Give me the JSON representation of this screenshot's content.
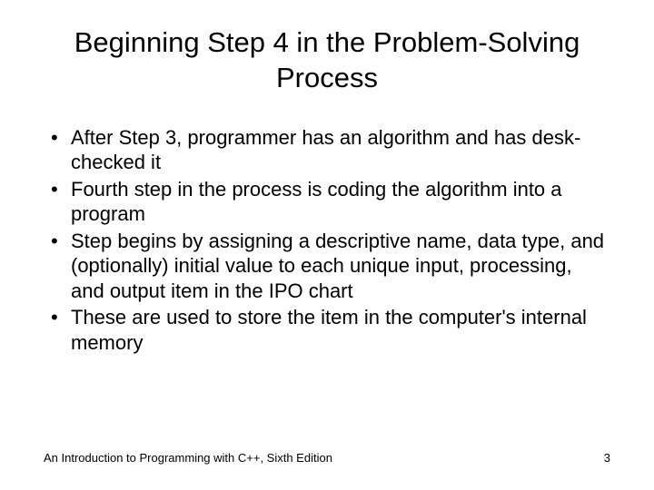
{
  "title": "Beginning Step 4 in the Problem-Solving Process",
  "bullets": [
    "After Step 3, programmer has an algorithm and has desk-checked it",
    "Fourth step in the process is coding the algorithm into a program",
    "Step begins by assigning a descriptive name, data type, and (optionally) initial value to each unique input, processing, and output item in the IPO chart",
    "These are used to store the item in the computer's internal memory"
  ],
  "footer": {
    "text": "An Introduction to Programming with C++, Sixth Edition",
    "page": "3"
  }
}
